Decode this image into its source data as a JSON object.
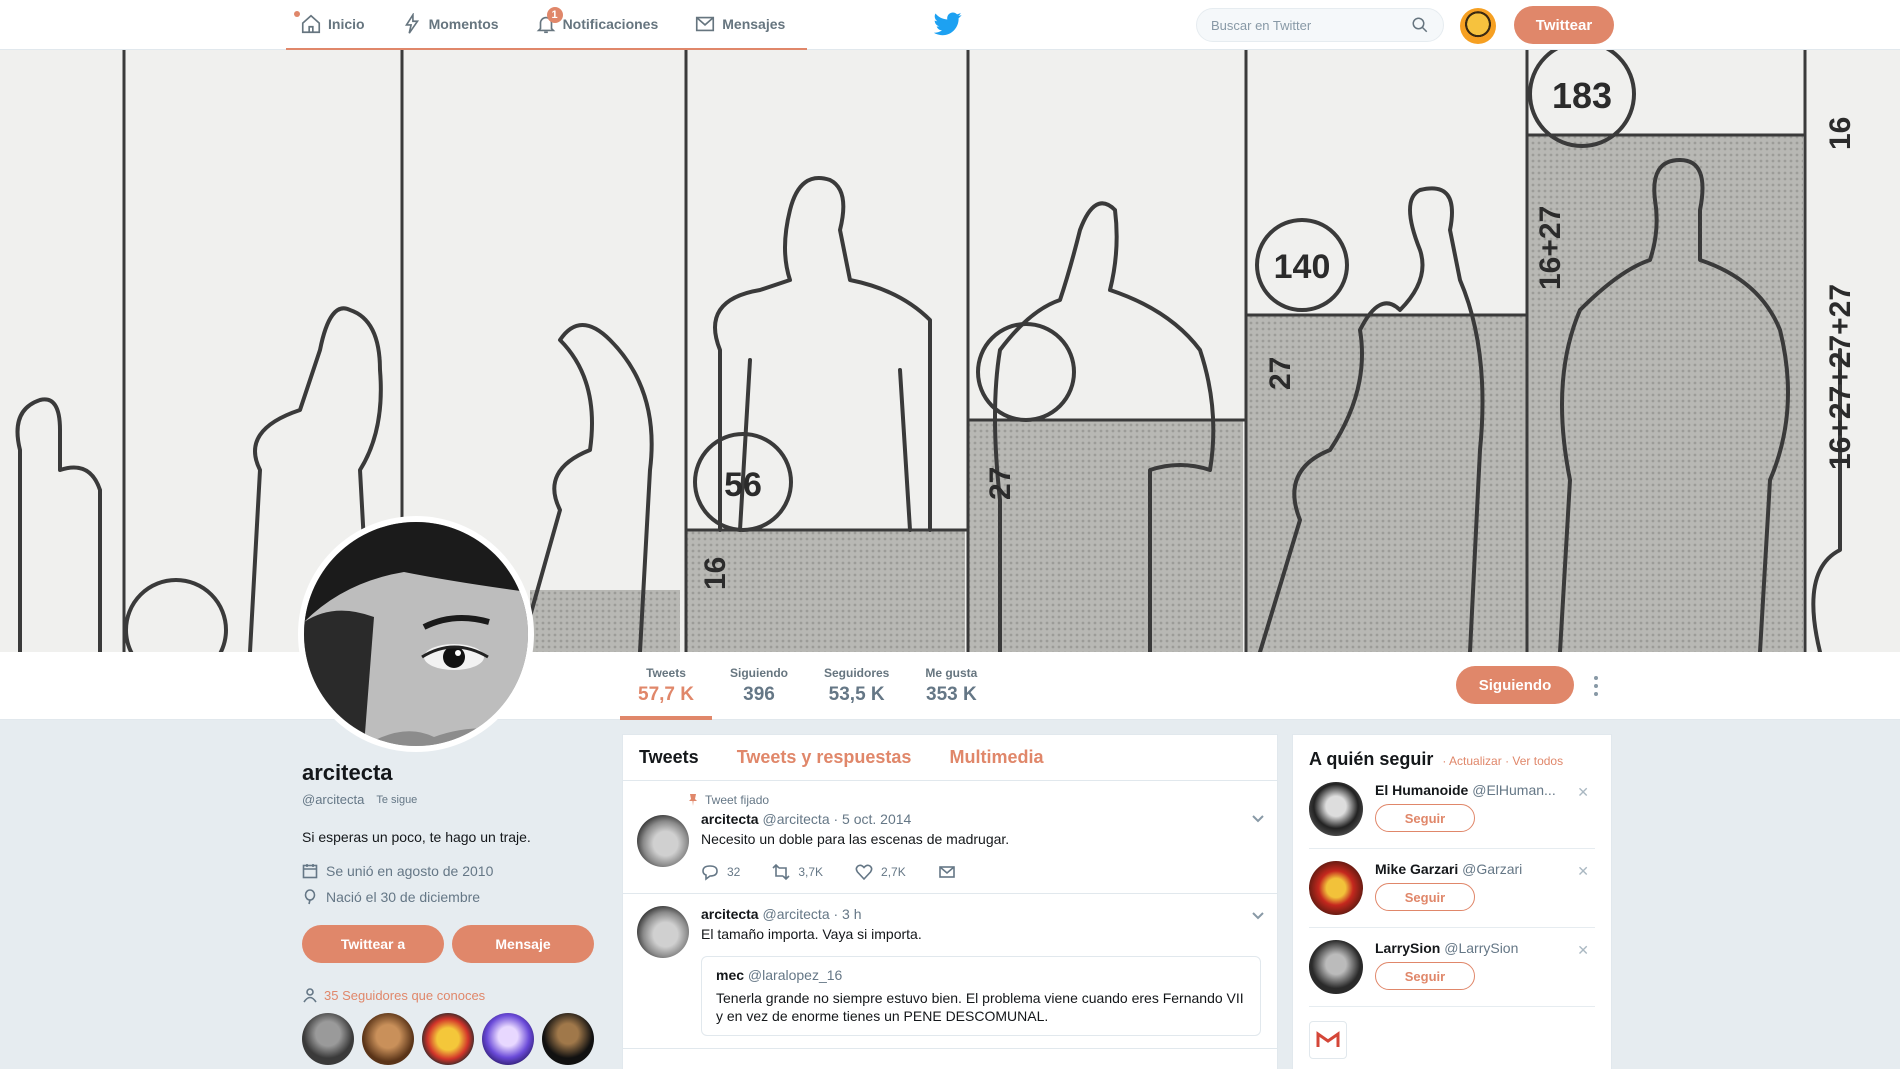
{
  "nav": {
    "home": "Inicio",
    "moments": "Momentos",
    "notifications": "Notificaciones",
    "notifications_count": "1",
    "messages": "Mensajes",
    "search_placeholder": "Buscar en Twitter",
    "tweet_button": "Twittear"
  },
  "banner": {
    "labels": [
      "183",
      "140",
      "56",
      "27",
      "27",
      "16",
      "16+27",
      "16+27+27+27",
      "16"
    ]
  },
  "stats": [
    {
      "label": "Tweets",
      "value": "57,7 K"
    },
    {
      "label": "Siguiendo",
      "value": "396"
    },
    {
      "label": "Seguidores",
      "value": "53,5 K"
    },
    {
      "label": "Me gusta",
      "value": "353 K"
    }
  ],
  "profile": {
    "following_button": "Siguiendo",
    "name": "arcitecta",
    "handle": "@arcitecta",
    "follows_you": "Te sigue",
    "bio": "Si esperas un poco, te hago un traje.",
    "joined": "Se unió en agosto de 2010",
    "born": "Nació el 30 de diciembre",
    "tweet_to": "Twittear a",
    "message": "Mensaje",
    "known_followers": "35 Seguidores que conoces"
  },
  "tabs": {
    "tweets": "Tweets",
    "replies": "Tweets y respuestas",
    "media": "Multimedia"
  },
  "tweets": [
    {
      "pinned": "Tweet fijado",
      "name": "arcitecta",
      "meta": "@arcitecta · 5 oct. 2014",
      "text": "Necesito un doble para las escenas de madrugar.",
      "replies": "32",
      "retweets": "3,7K",
      "likes": "2,7K"
    },
    {
      "name": "arcitecta",
      "meta": "@arcitecta · 3 h",
      "text": "El tamaño importa. Vaya si importa.",
      "quote": {
        "name": "mec",
        "handle": "@laralopez_16",
        "text": "Tenerla grande no siempre estuvo bien. El problema viene cuando eres Fernando VII y en vez de enorme tienes un PENE DESCOMUNAL."
      }
    }
  ],
  "who_to_follow": {
    "title": "A quién seguir",
    "links": "· Actualizar · Ver todos",
    "follow_label": "Seguir",
    "accounts": [
      {
        "name": "El Humanoide",
        "handle": "@ElHuman..."
      },
      {
        "name": "Mike Garzari",
        "handle": "@Garzari"
      },
      {
        "name": "LarrySion",
        "handle": "@LarrySion"
      }
    ]
  },
  "colors": {
    "accent": "#e0876a",
    "twitter_blue": "#1da1f2"
  }
}
